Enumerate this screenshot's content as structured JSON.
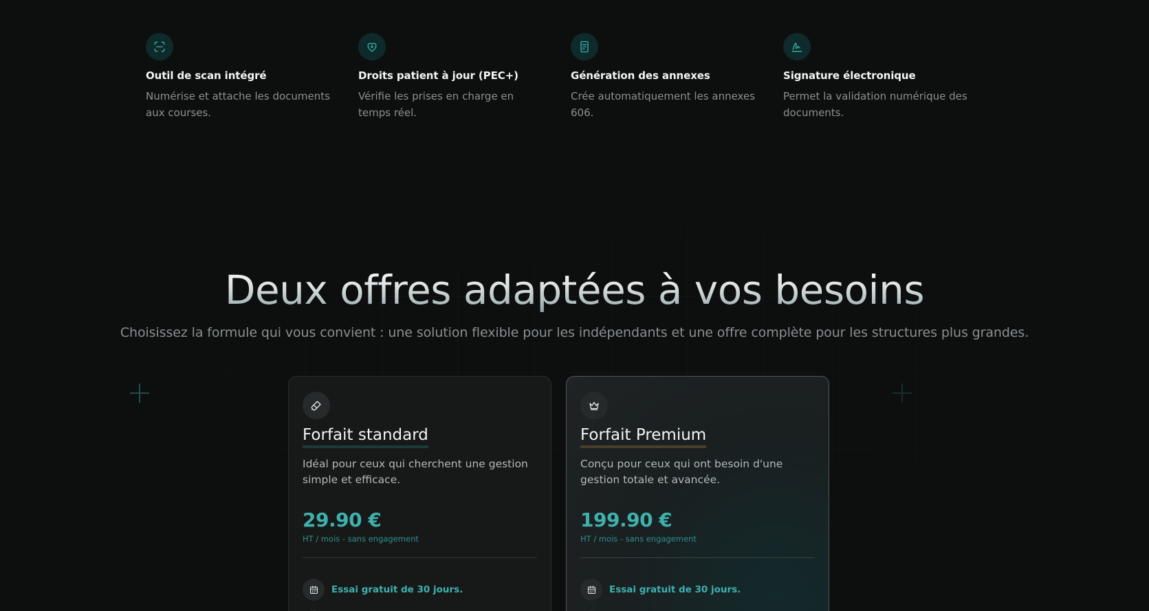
{
  "features": [
    {
      "icon": "scan-icon",
      "title": "Outil de scan intégré",
      "desc_line1": "Numérise et attache les documents",
      "desc_line2": "aux courses."
    },
    {
      "icon": "heart-icon",
      "title": "Droits patient à jour (PEC+)",
      "desc_line1": "Vérifie les prises en charge en",
      "desc_line2": "temps réel."
    },
    {
      "icon": "document-icon",
      "title": "Génération des annexes",
      "desc_line1": "Crée automatiquement les annexes",
      "desc_line2": "606."
    },
    {
      "icon": "signature-icon",
      "title": "Signature électronique",
      "desc_line1": "Permet la validation numérique des",
      "desc_line2": "documents."
    }
  ],
  "pricing": {
    "headline": "Deux offres adaptées à vos besoins",
    "subheadline": "Choisissez la formule qui vous convient : une solution flexible pour les indépendants et une offre complète pour les structures plus grandes.",
    "plans": [
      {
        "icon": "paintbrush-icon",
        "title": "Forfait standard",
        "desc_line1": "Idéal pour ceux qui cherchent une gestion",
        "desc_line2": "simple et efficace.",
        "price": "29.90 €",
        "price_note": "HT / mois - sans engagement",
        "feature_1": "Essai gratuit de 30 jours."
      },
      {
        "icon": "crown-icon",
        "title": "Forfait Premium",
        "desc_line1": "Conçu pour ceux qui ont besoin d'une",
        "desc_line2": "gestion totale et avancée.",
        "price": "199.90 €",
        "price_note": "HT / mois - sans engagement",
        "feature_1": "Essai gratuit de 30 jours."
      }
    ]
  },
  "colors": {
    "background": "#0d0f0f",
    "accent": "#3fb1ad",
    "icon_bg": "#0f2a2b",
    "card_bg": "#171919"
  }
}
